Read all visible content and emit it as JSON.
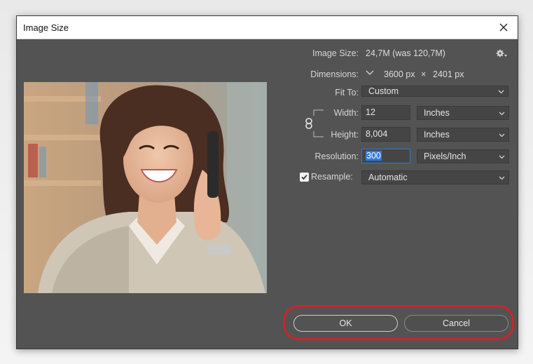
{
  "dialog": {
    "title": "Image Size",
    "close_icon": "close-icon"
  },
  "info": {
    "image_size_label": "Image Size:",
    "image_size_value": "24,7M (was 120,7M)",
    "dimensions_label": "Dimensions:",
    "dimensions_width": "3600 px",
    "dimensions_times": "×",
    "dimensions_height": "2401 px"
  },
  "fit_to": {
    "label": "Fit To:",
    "value": "Custom"
  },
  "width": {
    "label": "Width:",
    "value": "12",
    "unit": "Inches"
  },
  "height": {
    "label": "Height:",
    "value": "8,004",
    "unit": "Inches"
  },
  "resolution": {
    "label": "Resolution:",
    "value": "300",
    "unit": "Pixels/Inch"
  },
  "resample": {
    "label": "Resample:",
    "checked": true,
    "value": "Automatic"
  },
  "buttons": {
    "ok": "OK",
    "cancel": "Cancel"
  },
  "colors": {
    "dialog_bg": "#535353",
    "field_bg": "#454545",
    "focus_blue": "#2f7be0",
    "highlight_red": "#c9252b"
  },
  "icons": [
    "close-icon",
    "gear-icon",
    "chevron-down-icon",
    "link-icon",
    "checkmark-icon"
  ]
}
